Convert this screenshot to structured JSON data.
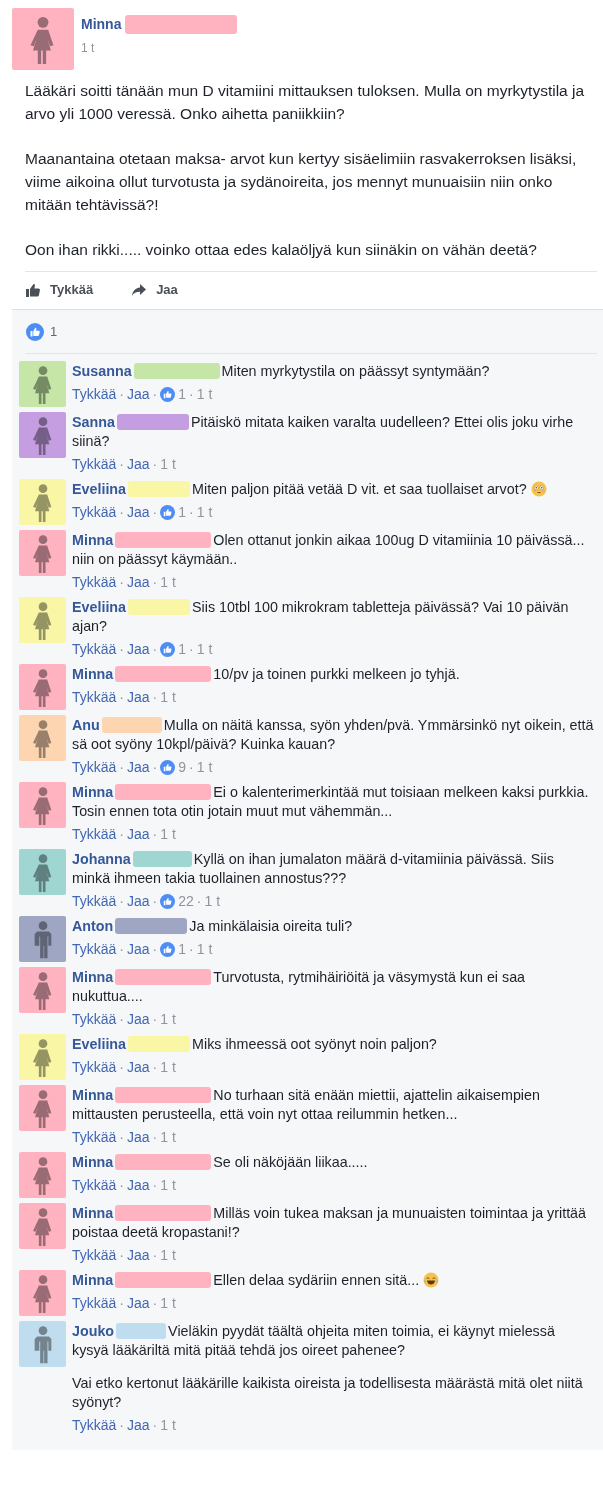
{
  "post": {
    "author": "Minna",
    "color": "#ffb3c1",
    "time": "1 t",
    "paragraphs": [
      "Lääkäri soitti tänään mun D vitamiini mittauksen tuloksen. Mulla on myrkytystila ja arvo yli 1000 veressä. Onko aihetta paniikkiin?",
      "Maanantaina otetaan maksa- arvot kun kertyy sisäelimiin rasvakerroksen lisäksi, viime aikoina ollut turvotusta ja sydänoireita, jos mennyt munuaisiin niin onko mitään tehtävissä?!",
      "Oon ihan rikki..... voinko ottaa edes kalaöljyä kun siinäkin on vähän deetä?"
    ],
    "actions": [
      {
        "kind": "like",
        "label": "Tykkää"
      },
      {
        "kind": "share",
        "label": "Jaa"
      }
    ],
    "reaction_count": "1"
  },
  "meta_separator": "·",
  "comments": [
    {
      "name": "Susanna",
      "color": "#c5e6a6",
      "kind": "woman",
      "paragraphs": [
        "Miten myrkytystila on päässyt syntymään?"
      ],
      "like": "Tykkää",
      "reply": "Jaa",
      "likes": "1",
      "time": "1 t"
    },
    {
      "name": "Sanna",
      "color": "#c49ee0",
      "kind": "woman",
      "paragraphs": [
        "Pitäiskö mitata kaiken varalta uudelleen? Ettei olis joku virhe siinä?"
      ],
      "like": "Tykkää",
      "reply": "Jaa",
      "time": "1 t"
    },
    {
      "name": "Eveliina",
      "color": "#f9f7a5",
      "kind": "woman",
      "paragraphs": [
        "Miten paljon pitää vetää D vit. et saa tuollaiset arvot?"
      ],
      "like": "Tykkää",
      "reply": "Jaa",
      "likes": "1",
      "time": "1 t"
    },
    {
      "name": "Minna",
      "color": "#ffb3c1",
      "kind": "woman",
      "paragraphs": [
        "Olen ottanut jonkin aikaa 100ug D vitamiinia 10 päivässä... niin on päässyt käymään.."
      ],
      "like": "Tykkää",
      "reply": "Jaa",
      "time": "1 t"
    },
    {
      "name": "Eveliina",
      "color": "#f9f7a5",
      "kind": "woman",
      "paragraphs": [
        "Siis 10tbl 100 mikrokram tabletteja päivässä? Vai 10 päivän ajan?"
      ],
      "like": "Tykkää",
      "reply": "Jaa",
      "likes": "1",
      "time": "1 t"
    },
    {
      "name": "Minna",
      "color": "#ffb3c1",
      "kind": "woman",
      "paragraphs": [
        "10/pv ja toinen purkki melkeen jo tyhjä."
      ],
      "like": "Tykkää",
      "reply": "Jaa",
      "time": "1 t"
    },
    {
      "name": "Anu",
      "color": "#fdd5b1",
      "kind": "woman",
      "paragraphs": [
        "Mulla on näitä kanssa, syön yhden/pvä. Ymmärsinkö nyt oikein, että sä oot syöny 10kpl/päivä? Kuinka kauan?"
      ],
      "like": "Tykkää",
      "reply": "Jaa",
      "likes": "9",
      "time": "1 t"
    },
    {
      "name": "Minna",
      "color": "#ffb3c1",
      "kind": "woman",
      "paragraphs": [
        "Ei o kalenterimerkintää mut toisiaan melkeen kaksi purkkia. Tosin ennen tota otin jotain muut mut vähemmän..."
      ],
      "like": "Tykkää",
      "reply": "Jaa",
      "time": "1 t"
    },
    {
      "name": "Johanna",
      "color": "#9fd6d2",
      "kind": "woman",
      "paragraphs": [
        "Kyllä on ihan jumalaton määrä d-vitamiinia päivässä. Siis minkä ihmeen takia tuollainen annostus???"
      ],
      "like": "Tykkää",
      "reply": "Jaa",
      "likes": "22",
      "time": "1 t"
    },
    {
      "name": "Anton",
      "color": "#9ea6c4",
      "kind": "man",
      "paragraphs": [
        "Ja minkälaisia oireita tuli?"
      ],
      "like": "Tykkää",
      "reply": "Jaa",
      "likes": "1",
      "time": "1 t"
    },
    {
      "name": "Minna",
      "color": "#ffb3c1",
      "kind": "woman",
      "paragraphs": [
        "Turvotusta, rytmihäiriöitä ja väsymystä kun ei saa nukuttua...."
      ],
      "like": "Tykkää",
      "reply": "Jaa",
      "time": "1 t"
    },
    {
      "name": "Eveliina",
      "color": "#f9f7a5",
      "kind": "woman",
      "paragraphs": [
        "Miks ihmeessä oot syönyt noin paljon?"
      ],
      "like": "Tykkää",
      "reply": "Jaa",
      "time": "1 t"
    },
    {
      "name": "Minna",
      "color": "#ffb3c1",
      "kind": "woman",
      "paragraphs": [
        "No turhaan sitä enään miettii, ajattelin aikaisempien mittausten perusteella, että voin nyt ottaa reilummin hetken..."
      ],
      "like": "Tykkää",
      "reply": "Jaa",
      "time": "1 t"
    },
    {
      "name": "Minna",
      "color": "#ffb3c1",
      "kind": "woman",
      "paragraphs": [
        "Se oli näköjään liikaa....."
      ],
      "like": "Tykkää",
      "reply": "Jaa",
      "time": "1 t"
    },
    {
      "name": "Minna",
      "color": "#ffb3c1",
      "kind": "woman",
      "paragraphs": [
        "Milläs voin tukea maksan ja munuaisten toimintaa ja yrittää poistaa deetä kropastani!?"
      ],
      "like": "Tykkää",
      "reply": "Jaa",
      "time": "1 t"
    },
    {
      "name": "Minna",
      "color": "#ffb3c1",
      "kind": "woman",
      "paragraphs": [
        "Ellen delaa sydäriin ennen sitä..."
      ],
      "like": "Tykkää",
      "reply": "Jaa",
      "time": "1 t"
    },
    {
      "name": "Jouko",
      "color": "#c0dcef",
      "kind": "man",
      "paragraphs": [
        "Vieläkin pyydät täältä ohjeita miten toimia, ei käynyt mielessä kysyä lääkäriltä mitä pitää tehdä jos oireet pahenee?",
        "Vai etko kertonut lääkärille kaikista oireista ja todellisesta määrästä mitä olet niitä syönyt?"
      ],
      "like": "Tykkää",
      "reply": "Jaa",
      "time": "1 t"
    }
  ]
}
